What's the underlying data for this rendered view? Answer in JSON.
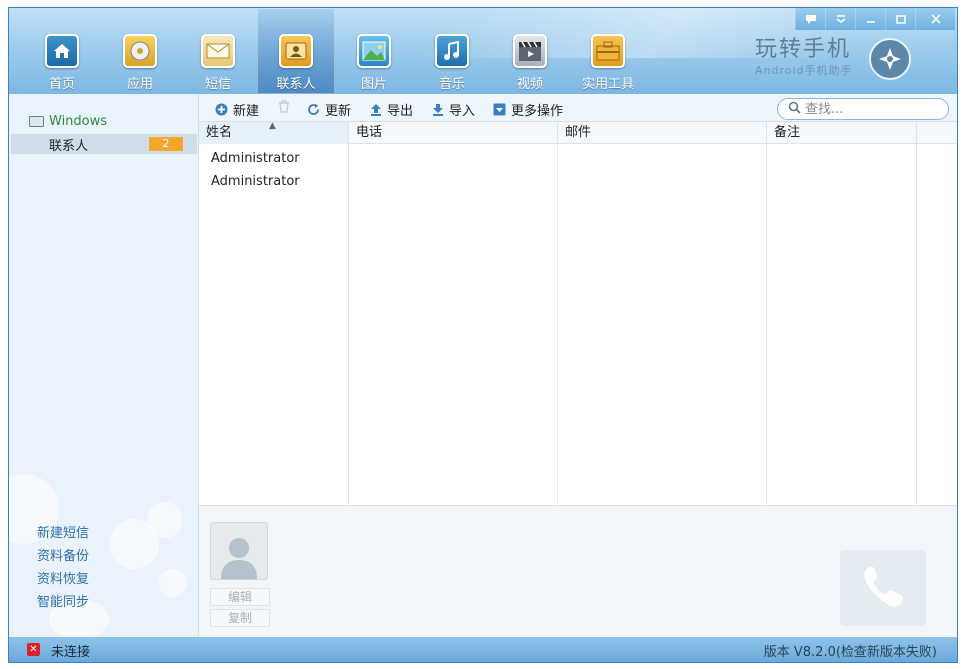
{
  "window": {
    "controls": [
      "feedback-icon",
      "menu-icon",
      "minimize-icon",
      "maximize-icon",
      "close-icon"
    ]
  },
  "nav": {
    "items": [
      {
        "label": "首页",
        "icon": "home-icon"
      },
      {
        "label": "应用",
        "icon": "disc-icon"
      },
      {
        "label": "短信",
        "icon": "envelope-icon"
      },
      {
        "label": "联系人",
        "icon": "contact-card-icon",
        "active": true
      },
      {
        "label": "图片",
        "icon": "picture-icon"
      },
      {
        "label": "音乐",
        "icon": "music-note-icon"
      },
      {
        "label": "视频",
        "icon": "clapperboard-icon"
      },
      {
        "label": "实用工具",
        "icon": "toolbox-icon"
      }
    ]
  },
  "brand": {
    "title": "玩转手机",
    "subtitle": "Android手机助手"
  },
  "sidebar": {
    "root_label": "Windows",
    "item_label": "联系人",
    "item_count": "2",
    "links": [
      "新建短信",
      "资料备份",
      "资料恢复",
      "智能同步"
    ]
  },
  "toolbar": {
    "new_label": "新建",
    "refresh_label": "更新",
    "export_label": "导出",
    "import_label": "导入",
    "more_label": "更多操作",
    "search_placeholder": "查找..."
  },
  "table": {
    "columns": [
      "姓名",
      "电话",
      "邮件",
      "备注"
    ],
    "rows": [
      {
        "name": "Administrator"
      },
      {
        "name": "Administrator"
      }
    ]
  },
  "detail": {
    "edit_label": "编辑",
    "copy_label": "复制"
  },
  "status": {
    "connection": "未连接",
    "version": "版本 V8.2.0(检查新版本失败)"
  },
  "colors": {
    "header_top": "#bfe0f6",
    "header_bottom": "#7db7e3",
    "badge": "#f3a72b",
    "status_error": "#d9222a",
    "sidebar_link": "#2f6fa6"
  }
}
